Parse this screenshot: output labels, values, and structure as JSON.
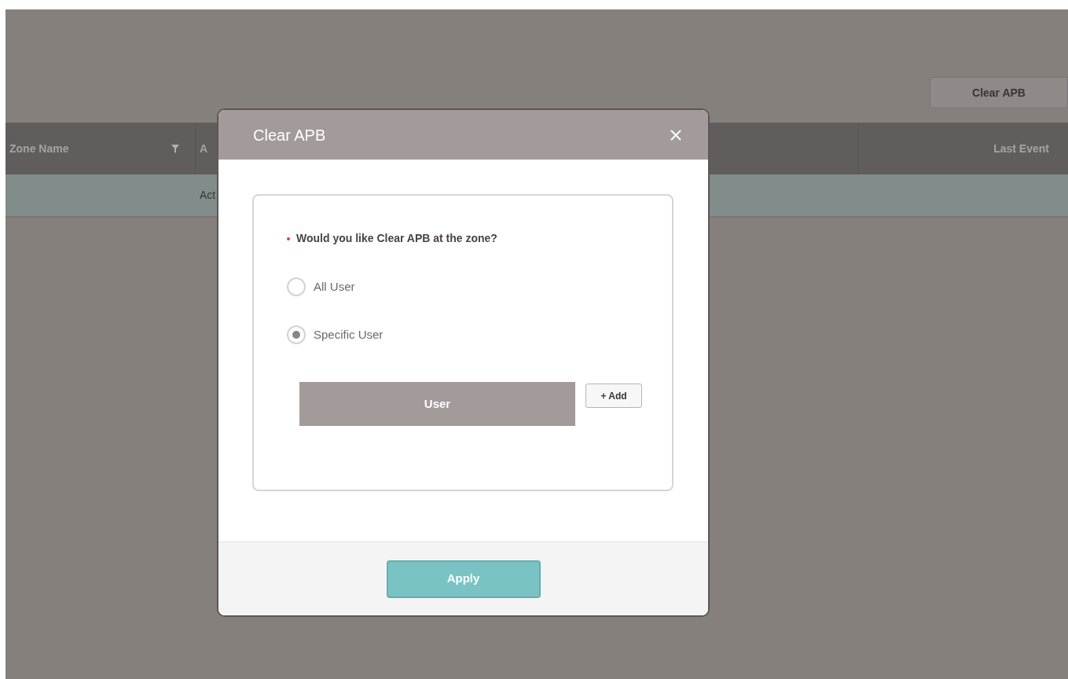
{
  "toolbar": {
    "button": "Clear APB"
  },
  "table": {
    "columns": [
      {
        "label": "Zone Name",
        "kind": "filterable"
      },
      {
        "label": "A",
        "kind": "plain"
      },
      {
        "kind": "plain"
      },
      {
        "label": "Last Event",
        "kind": "plain"
      }
    ],
    "rows": [
      {
        "selected": true,
        "cells": [
          "",
          "Act",
          "",
          ""
        ]
      }
    ]
  },
  "dialog": {
    "title": "Clear APB",
    "question": "Would you like Clear APB at the zone?",
    "required": true,
    "options": [
      {
        "label": "All User",
        "selected": false
      },
      {
        "label": "Specific User",
        "selected": true
      }
    ],
    "user_table": {
      "column": "User"
    },
    "add_button": "+ Add",
    "apply_button": "Apply"
  }
}
